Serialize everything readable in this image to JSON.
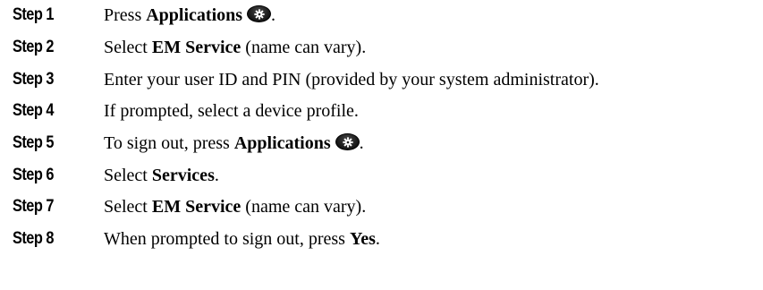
{
  "steps": [
    {
      "label": "Step 1",
      "parts": [
        {
          "t": "Press "
        },
        {
          "t": "Applications",
          "b": true
        },
        {
          "icon": "applications-icon"
        },
        {
          "t": "."
        }
      ]
    },
    {
      "label": "Step 2",
      "parts": [
        {
          "t": "Select "
        },
        {
          "t": "EM Service",
          "b": true
        },
        {
          "t": " (name can vary)."
        }
      ]
    },
    {
      "label": "Step 3",
      "parts": [
        {
          "t": "Enter your user ID and PIN (provided by your system administrator)."
        }
      ]
    },
    {
      "label": "Step 4",
      "parts": [
        {
          "t": "If prompted, select a device profile."
        }
      ]
    },
    {
      "label": "Step 5",
      "parts": [
        {
          "t": "To sign out, press "
        },
        {
          "t": "Applications",
          "b": true
        },
        {
          "icon": "applications-icon"
        },
        {
          "t": "."
        }
      ]
    },
    {
      "label": "Step 6",
      "parts": [
        {
          "t": "Select "
        },
        {
          "t": "Services",
          "b": true
        },
        {
          "t": "."
        }
      ]
    },
    {
      "label": "Step 7",
      "parts": [
        {
          "t": "Select "
        },
        {
          "t": "EM Service",
          "b": true
        },
        {
          "t": " (name can vary)."
        }
      ]
    },
    {
      "label": "Step 8",
      "parts": [
        {
          "t": "When prompted to sign out, press "
        },
        {
          "t": "Yes",
          "b": true
        },
        {
          "t": "."
        }
      ]
    }
  ]
}
